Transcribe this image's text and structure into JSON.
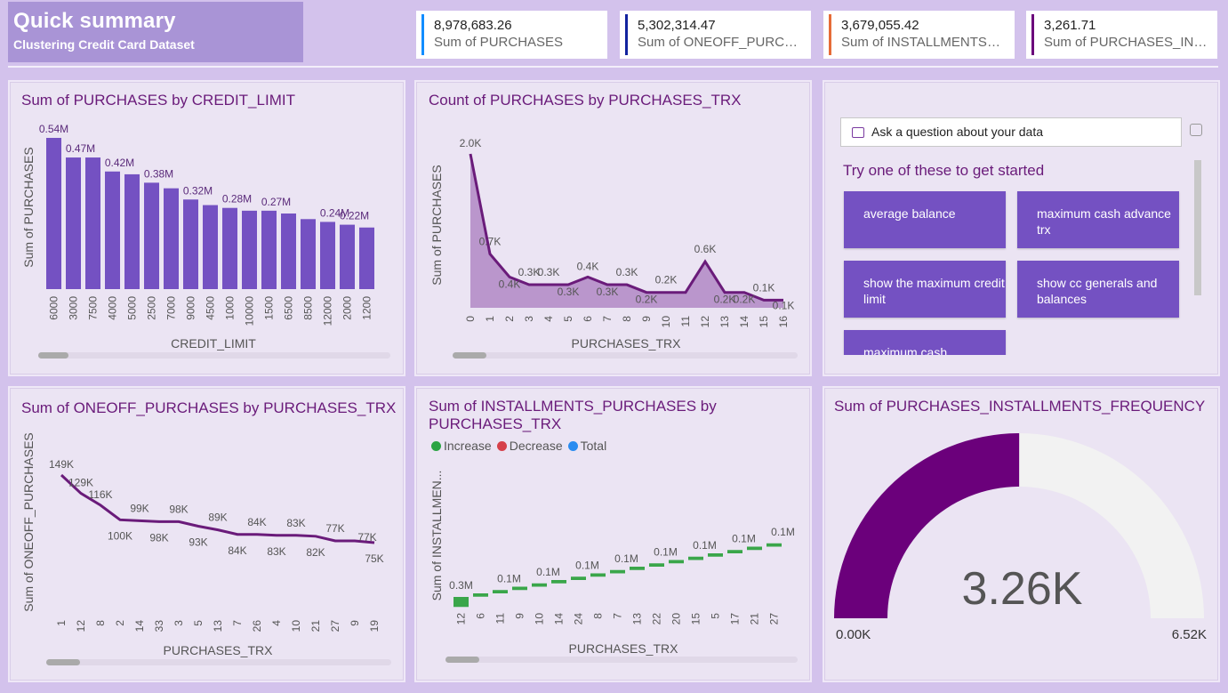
{
  "header": {
    "title": "Quick summary",
    "subtitle": "Clustering Credit Card Dataset"
  },
  "kpis": [
    {
      "value": "8,978,683.26",
      "label": "Sum of PURCHASES",
      "color": "#118dff"
    },
    {
      "value": "5,302,314.47",
      "label": "Sum of ONEOFF_PURCH...",
      "color": "#12239e"
    },
    {
      "value": "3,679,055.42",
      "label": "Sum of INSTALLMENTS_P...",
      "color": "#e66c37"
    },
    {
      "value": "3,261.71",
      "label": "Sum of PURCHASES_INS...",
      "color": "#6b007b"
    }
  ],
  "colors": {
    "bar": "#7451c2",
    "line": "#6a1b7a",
    "waterfall": "#3aa64a",
    "gauge_fill": "#6b007b",
    "gauge_bg": "#f2f2f2"
  },
  "chart1": {
    "title": "Sum of PURCHASES by CREDIT_LIMIT",
    "xlabel": "CREDIT_LIMIT",
    "ylabel": "Sum of PURCHASES",
    "labels": [
      "0.54M",
      "0.47M",
      "0.42M",
      "0.38M",
      "0.32M",
      "0.28M",
      "0.27M",
      "0.24M",
      "0.22M"
    ]
  },
  "chart2": {
    "title": "Count of PURCHASES by PURCHASES_TRX",
    "xlabel": "PURCHASES_TRX",
    "ylabel": "Sum of PURCHASES"
  },
  "chart3": {
    "title": "Sum of ONEOFF_PURCHASES by PURCHASES_TRX",
    "xlabel": "PURCHASES_TRX",
    "ylabel": "Sum of ONEOFF_PURCHASES"
  },
  "chart4": {
    "title_line1": "Sum of INSTALLMENTS_PURCHASES by",
    "title_line2": "PURCHASES_TRX",
    "xlabel": "PURCHASES_TRX",
    "ylabel": "Sum of INSTALLMEN...",
    "legend": {
      "increase": "Increase",
      "decrease": "Decrease",
      "total": "Total",
      "increase_color": "#2ca444",
      "decrease_color": "#d6404a",
      "total_color": "#2a8cf0"
    }
  },
  "qa": {
    "placeholder": "Ask a question about your data",
    "hint": "Try one of these to get started",
    "suggestions": [
      "average balance",
      "maximum cash advance trx",
      "show the maximum credit limit",
      "show cc generals and balances",
      "maximum cash"
    ]
  },
  "gauge": {
    "title": "Sum of PURCHASES_INSTALLMENTS_FREQUENCY",
    "value_label": "3.26K",
    "min_label": "0.00K",
    "max_label": "6.52K",
    "value": 3261.71,
    "min": 0,
    "max": 6520
  },
  "chart_data": [
    {
      "type": "bar",
      "title": "Sum of PURCHASES by CREDIT_LIMIT",
      "xlabel": "CREDIT_LIMIT",
      "ylabel": "Sum of PURCHASES",
      "categories": [
        "6000",
        "3000",
        "7500",
        "4000",
        "5000",
        "2500",
        "7000",
        "9000",
        "4500",
        "1000",
        "10000",
        "1500",
        "6500",
        "8500",
        "12000",
        "2000",
        "1200"
      ],
      "values": [
        0.54,
        0.47,
        0.47,
        0.42,
        0.41,
        0.38,
        0.36,
        0.32,
        0.3,
        0.29,
        0.28,
        0.28,
        0.27,
        0.25,
        0.24,
        0.23,
        0.22
      ],
      "value_unit": "M",
      "ylim": [
        0,
        0.6
      ]
    },
    {
      "type": "area",
      "title": "Count of PURCHASES by PURCHASES_TRX",
      "xlabel": "PURCHASES_TRX",
      "ylabel": "Sum of PURCHASES",
      "categories": [
        "0",
        "1",
        "2",
        "3",
        "4",
        "5",
        "6",
        "7",
        "8",
        "9",
        "10",
        "11",
        "12",
        "13",
        "14",
        "15",
        "16"
      ],
      "values": [
        2.0,
        0.7,
        0.4,
        0.3,
        0.3,
        0.3,
        0.4,
        0.3,
        0.3,
        0.2,
        0.2,
        0.2,
        0.6,
        0.2,
        0.2,
        0.1,
        0.1
      ],
      "labels": [
        "2.0K",
        "0.7K",
        "0.4K",
        "0.3K",
        "0.3K",
        "0.3K",
        "0.4K",
        "0.3K",
        "0.3K",
        "0.2K",
        "0.2K",
        "",
        "0.6K",
        "0.2K",
        "0.2K",
        "0.1K",
        "0.1K"
      ],
      "value_unit": "K",
      "ylim": [
        0,
        2.2
      ]
    },
    {
      "type": "line",
      "title": "Sum of ONEOFF_PURCHASES by PURCHASES_TRX",
      "xlabel": "PURCHASES_TRX",
      "ylabel": "Sum of ONEOFF_PURCHASES",
      "categories": [
        "1",
        "12",
        "8",
        "2",
        "14",
        "33",
        "3",
        "5",
        "13",
        "7",
        "26",
        "4",
        "10",
        "21",
        "27",
        "9",
        "19"
      ],
      "values": [
        149,
        129,
        116,
        100,
        99,
        98,
        98,
        93,
        89,
        84,
        84,
        83,
        83,
        82,
        77,
        77,
        75
      ],
      "labels": [
        "149K",
        "129K",
        "116K",
        "100K",
        "99K",
        "98K",
        "98K",
        "93K",
        "89K",
        "84K",
        "84K",
        "83K",
        "83K",
        "82K",
        "77K",
        "77K",
        "75K"
      ],
      "value_unit": "K",
      "ylim": [
        0,
        160
      ]
    },
    {
      "type": "bar",
      "subtype": "waterfall",
      "title": "Sum of INSTALLMENTS_PURCHASES by PURCHASES_TRX",
      "xlabel": "PURCHASES_TRX",
      "ylabel": "Sum of INSTALLMEN...",
      "categories": [
        "12",
        "6",
        "11",
        "9",
        "10",
        "14",
        "24",
        "8",
        "7",
        "13",
        "22",
        "20",
        "15",
        "5",
        "17",
        "21",
        "27"
      ],
      "values": [
        0.3,
        0.1,
        0.1,
        0.1,
        0.1,
        0.1,
        0.1,
        0.1,
        0.1,
        0.1,
        0.1,
        0.1,
        0.1,
        0.1,
        0.1,
        0.1,
        0.1
      ],
      "labels": [
        "0.3M",
        "0.1M",
        "0.1M",
        "0.1M",
        "0.1M",
        "0.1M",
        "0.1M",
        "0.1M",
        "0.1M",
        "0.1M",
        "0.1M",
        "0.1M",
        "0.1M",
        "0.1M",
        "0.1M",
        "0.1M",
        "0.1M"
      ],
      "value_unit": "M",
      "ylim": [
        0,
        3.7
      ]
    },
    {
      "type": "gauge",
      "title": "Sum of PURCHASES_INSTALLMENTS_FREQUENCY",
      "value": 3261.71,
      "min": 0,
      "max": 6520
    }
  ]
}
